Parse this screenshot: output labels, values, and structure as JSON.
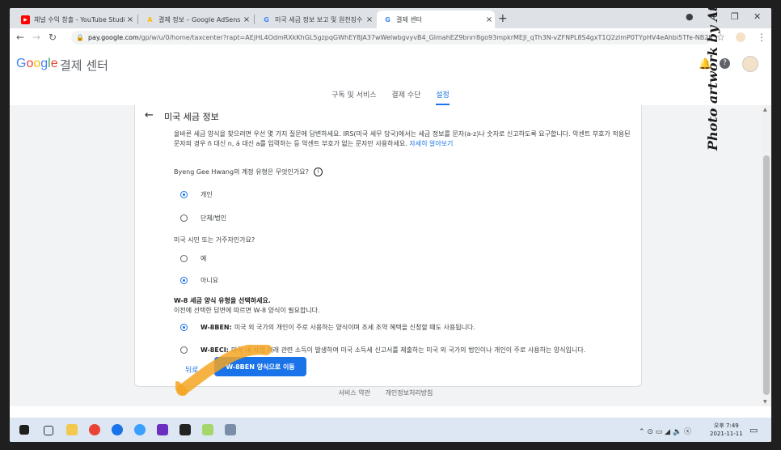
{
  "tabs": [
    {
      "title": "채널 수익 창출 - YouTube Studi",
      "fav": "▶",
      "fav_color": "#ff0000"
    },
    {
      "title": "결제 정보 – Google AdSense",
      "fav": "A",
      "fav_color": "#fbbc05"
    },
    {
      "title": "미국 세금 정보 보고 및 원천징수",
      "fav": "G",
      "fav_color": "#4285f4"
    },
    {
      "title": "결제 센터",
      "fav": "G",
      "fav_color": "#4285f4"
    }
  ],
  "url": {
    "host": "pay.google.com",
    "path": "/gp/w/u/0/home/taxcenter?rapt=AEjHL4OdmRXkKhGL5gzpqGWhEY8JA37wWelwbgvyvB4_GlmahEZ9bnrr8go93mpkrMEJl_qTh3N-vZFNPL8S4gxT1Q2zlmP0TYpHV4eAhbi5Tfe-NB2h1Z88r..."
  },
  "app": {
    "logo": "Google",
    "title": "결제 센터"
  },
  "subnav": {
    "items": [
      "구독 및 서비스",
      "결제 수단",
      "설정"
    ],
    "active": 2
  },
  "form": {
    "heading": "미국 세금 정보",
    "intro": "올바른 세금 양식을 찾으려면 우선 몇 가지 질문에 답변하세요. IRS(미국 세무 당국)에서는 세금 정보를 문자(a-z)나 숫자로 신고하도록 요구합니다. 악센트 부호가 적용된 문자의 경우 ñ 대신 n, á 대신 a를 입력하는 등 악센트 부호가 없는 문자만 사용하세요.",
    "intro_link": "자세히 알아보기",
    "q1": "Byeng Gee Hwang의 계정 유형은 무엇인가요?",
    "q1_options": [
      "개인",
      "단체/법인"
    ],
    "q1_selected": 0,
    "q2": "미국 시민 또는 거주자인가요?",
    "q2_options": [
      "예",
      "아니요"
    ],
    "q2_selected": 1,
    "q3_title": "W-8 세금 양식 유형을 선택하세요.",
    "q3_sub": "이전에 선택한 답변에 따르면 W-8 양식이 필요합니다.",
    "q3_options": [
      {
        "code": "W-8BEN:",
        "text": "미국 외 국가의 개인이 주로 사용하는 양식이며 조세 조약 혜택을 신청할 때도 사용됩니다."
      },
      {
        "code": "W-8ECI:",
        "text": "미국 내 사업 거래 관련 소득이 발생하여 미국 소득세 신고서를 제출하는 미국 외 국가의 법인이나 개인이 주로 사용하는 양식입니다."
      }
    ],
    "q3_selected": 0,
    "back_label": "뒤로",
    "primary_label": "W-8BEN 양식으로 이동"
  },
  "footer": {
    "links": [
      "서비스 약관",
      "개인정보처리방침"
    ]
  },
  "watermark": "Photo artwork by Atlas",
  "taskbar": {
    "time": "오후 7:49",
    "date": "2021-11-11"
  }
}
